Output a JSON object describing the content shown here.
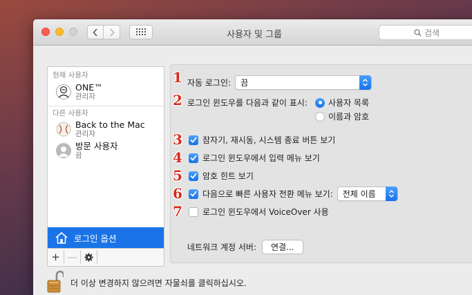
{
  "window": {
    "title": "사용자 및 그룹",
    "search_placeholder": "검색"
  },
  "sidebar": {
    "current_users_label": "현재 사용자",
    "other_users_label": "다른 사용자",
    "current_user": {
      "name": "ONE™",
      "role": "관리자",
      "icon": "profile-avatar-icon"
    },
    "other_users": [
      {
        "name": "Back to the Mac",
        "role": "관리자",
        "icon": "baseball-avatar-icon"
      },
      {
        "name": "방문 사용자",
        "role": "끔",
        "icon": "guest-avatar-icon"
      }
    ],
    "login_options_label": "로그인 옵션",
    "tools": {
      "add": "+",
      "remove": "—",
      "gear": "gear-icon"
    }
  },
  "main": {
    "auto_login": {
      "label": "자동 로그인:",
      "value": "끔"
    },
    "display_login_window": {
      "label": "로그인 윈도우를 다음과 같이 표시:",
      "options": [
        {
          "label": "사용자 목록",
          "selected": true
        },
        {
          "label": "이름과 암호",
          "selected": false
        }
      ]
    },
    "checkboxes": [
      {
        "label": "잠자기, 재시동, 시스템 종료 버튼 보기",
        "checked": true
      },
      {
        "label": "로그인 윈도우에서 입력 메뉴 보기",
        "checked": true
      },
      {
        "label": "암호 힌트 보기",
        "checked": true
      },
      {
        "label": "다음으로 빠른 사용자 전환 메뉴 보기:",
        "checked": true
      },
      {
        "label": "로그인 윈도우에서 VoiceOver 사용",
        "checked": false
      }
    ],
    "fast_switch_value": "전체 이름",
    "network_server": {
      "label": "네트워크 계정 서버:",
      "button": "연결..."
    }
  },
  "annotations": [
    "1",
    "2",
    "3",
    "4",
    "5",
    "6",
    "7"
  ],
  "lock": {
    "text": "더 이상 변경하지 않으려면 자물쇠를 클릭하십시오."
  },
  "colors": {
    "accent": "#1a74e8",
    "annotation": "#d32d1e"
  }
}
